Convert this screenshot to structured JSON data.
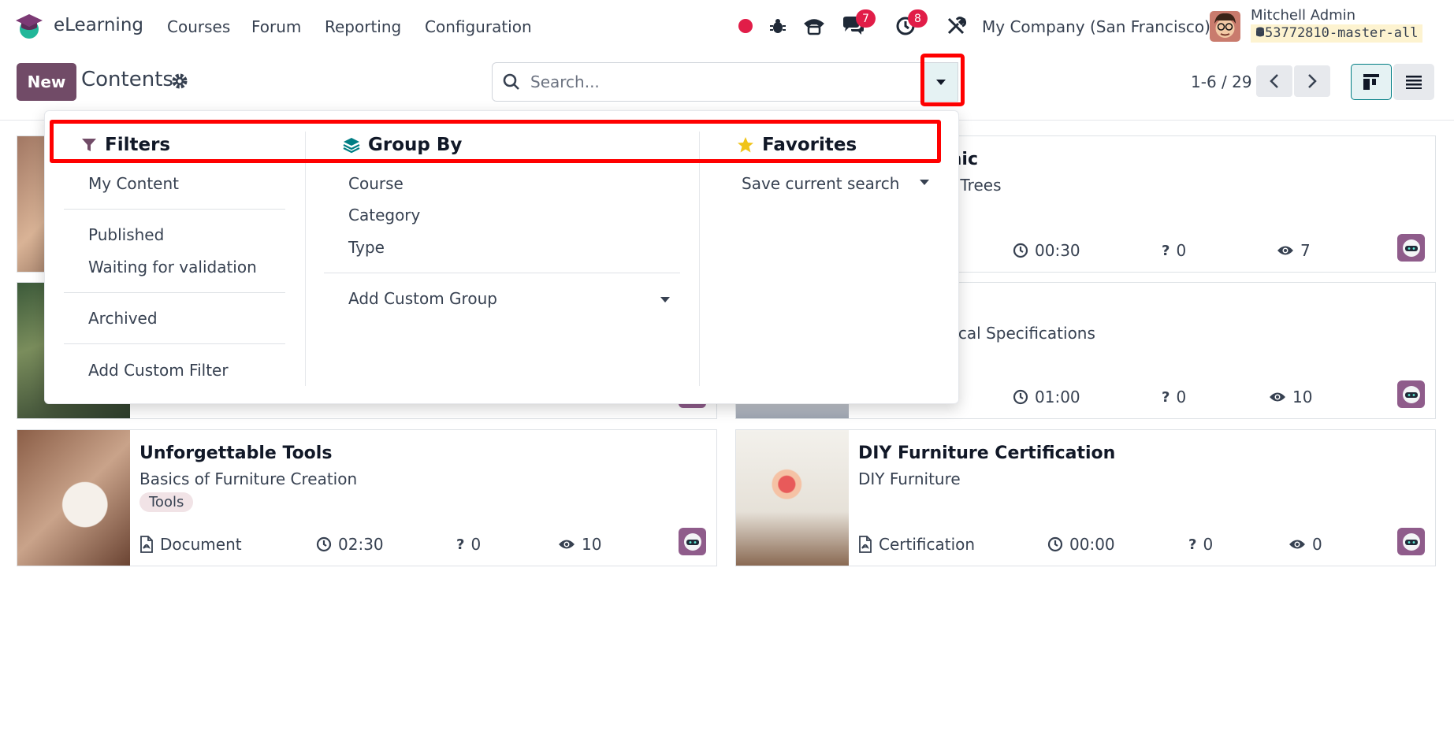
{
  "navbar": {
    "app_name": "eLearning",
    "menus": [
      "Courses",
      "Forum",
      "Reporting",
      "Configuration"
    ],
    "messages_badge": "7",
    "activities_badge": "8",
    "company": "My Company (San Francisco)",
    "user_name": "Mitchell Admin",
    "database": "53772810-master-all",
    "icons": [
      "record-dot-icon",
      "bug-icon",
      "phone-icon",
      "chat-icon",
      "clock-icon",
      "tools-icon"
    ]
  },
  "control_panel": {
    "new_label": "New",
    "title": "Contents",
    "search_placeholder": "Search...",
    "pager": "1-6 / 29"
  },
  "dropdown": {
    "filters": {
      "heading": "Filters",
      "items": [
        "My Content",
        "Published",
        "Waiting for validation",
        "Archived",
        "Add Custom Filter"
      ]
    },
    "group_by": {
      "heading": "Group By",
      "items": [
        "Course",
        "Category",
        "Type",
        "Add Custom Group"
      ]
    },
    "favorites": {
      "heading": "Favorites",
      "items": [
        "Save current search"
      ]
    }
  },
  "cards": [
    {
      "title_partial": "phic",
      "subtitle_partial": "f Trees",
      "duration": "00:30",
      "questions": "0",
      "views": "7"
    },
    {
      "subtitle_partial": "hnical Specifications",
      "duration": "01:00",
      "questions": "0",
      "views": "10"
    },
    {
      "title": "Unforgettable Tools",
      "subtitle": "Basics of Furniture Creation",
      "tag": "Tools",
      "type": "Document",
      "duration": "02:30",
      "questions": "0",
      "views": "10"
    },
    {
      "title": "DIY Furniture Certification",
      "subtitle": "DIY Furniture",
      "type": "Certification",
      "duration": "00:00",
      "questions": "0",
      "views": "0"
    }
  ],
  "colors": {
    "primary": "#714b67",
    "accent": "#017e84",
    "badge": "#e11d48",
    "highlight": "#ff0000"
  }
}
